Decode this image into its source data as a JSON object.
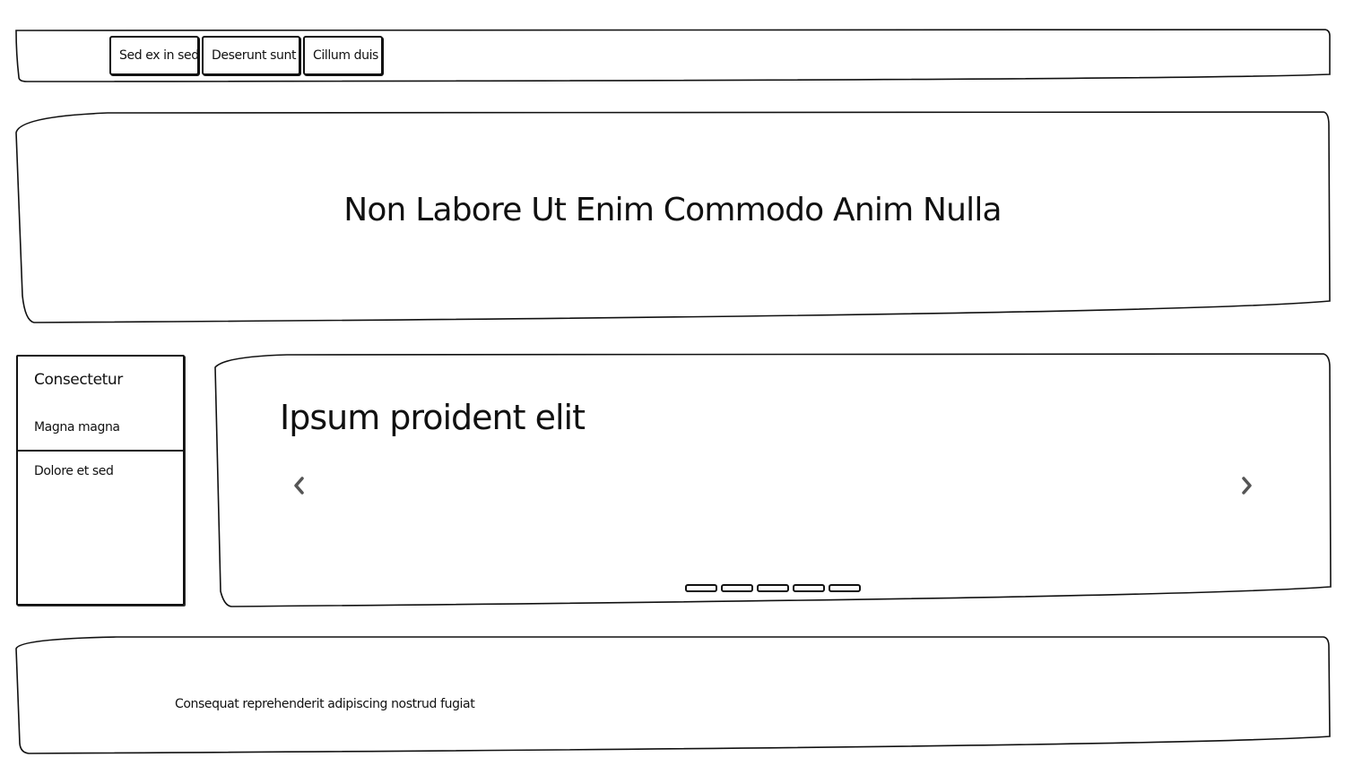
{
  "nav": {
    "buttons": [
      {
        "label": "Sed ex in sed"
      },
      {
        "label": "Deserunt sunt"
      },
      {
        "label": "Cillum duis"
      }
    ]
  },
  "hero": {
    "title": "Non Labore Ut Enim Commodo Anim Nulla"
  },
  "sidebar": {
    "title": "Consectetur",
    "items": [
      {
        "label": "Magna magna"
      },
      {
        "label": "Dolore et sed"
      }
    ]
  },
  "carousel": {
    "title": "Ipsum proident elit",
    "prev_icon": "chevron-left-icon",
    "next_icon": "chevron-right-icon",
    "slide_count": 5
  },
  "footer": {
    "text": "Consequat reprehenderit adipiscing nostrud fugiat"
  }
}
